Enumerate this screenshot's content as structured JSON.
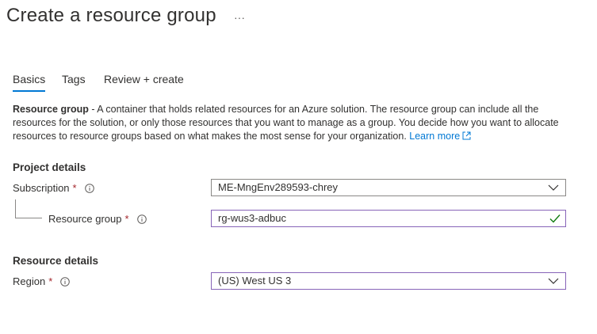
{
  "page": {
    "title": "Create a resource group",
    "more_label": "···"
  },
  "tabs": [
    {
      "label": "Basics",
      "active": true
    },
    {
      "label": "Tags",
      "active": false
    },
    {
      "label": "Review + create",
      "active": false
    }
  ],
  "description": {
    "bold": "Resource group",
    "text": " - A container that holds related resources for an Azure solution. The resource group can include all the resources for the solution, or only those resources that you want to manage as a group. You decide how you want to allocate resources to resource groups based on what makes the most sense for your organization. ",
    "link": "Learn more"
  },
  "project_details": {
    "heading": "Project details",
    "subscription": {
      "label": "Subscription",
      "required_mark": "*",
      "value": "ME-MngEnv289593-chrey"
    },
    "resource_group": {
      "label": "Resource group",
      "required_mark": "*",
      "value": "rg-wus3-adbuc"
    }
  },
  "resource_details": {
    "heading": "Resource details",
    "region": {
      "label": "Region",
      "required_mark": "*",
      "value": "(US) West US 3"
    }
  },
  "colors": {
    "accent": "#0078d4",
    "focus_border": "#8764b8",
    "valid": "#107c10",
    "required": "#a4262c"
  }
}
